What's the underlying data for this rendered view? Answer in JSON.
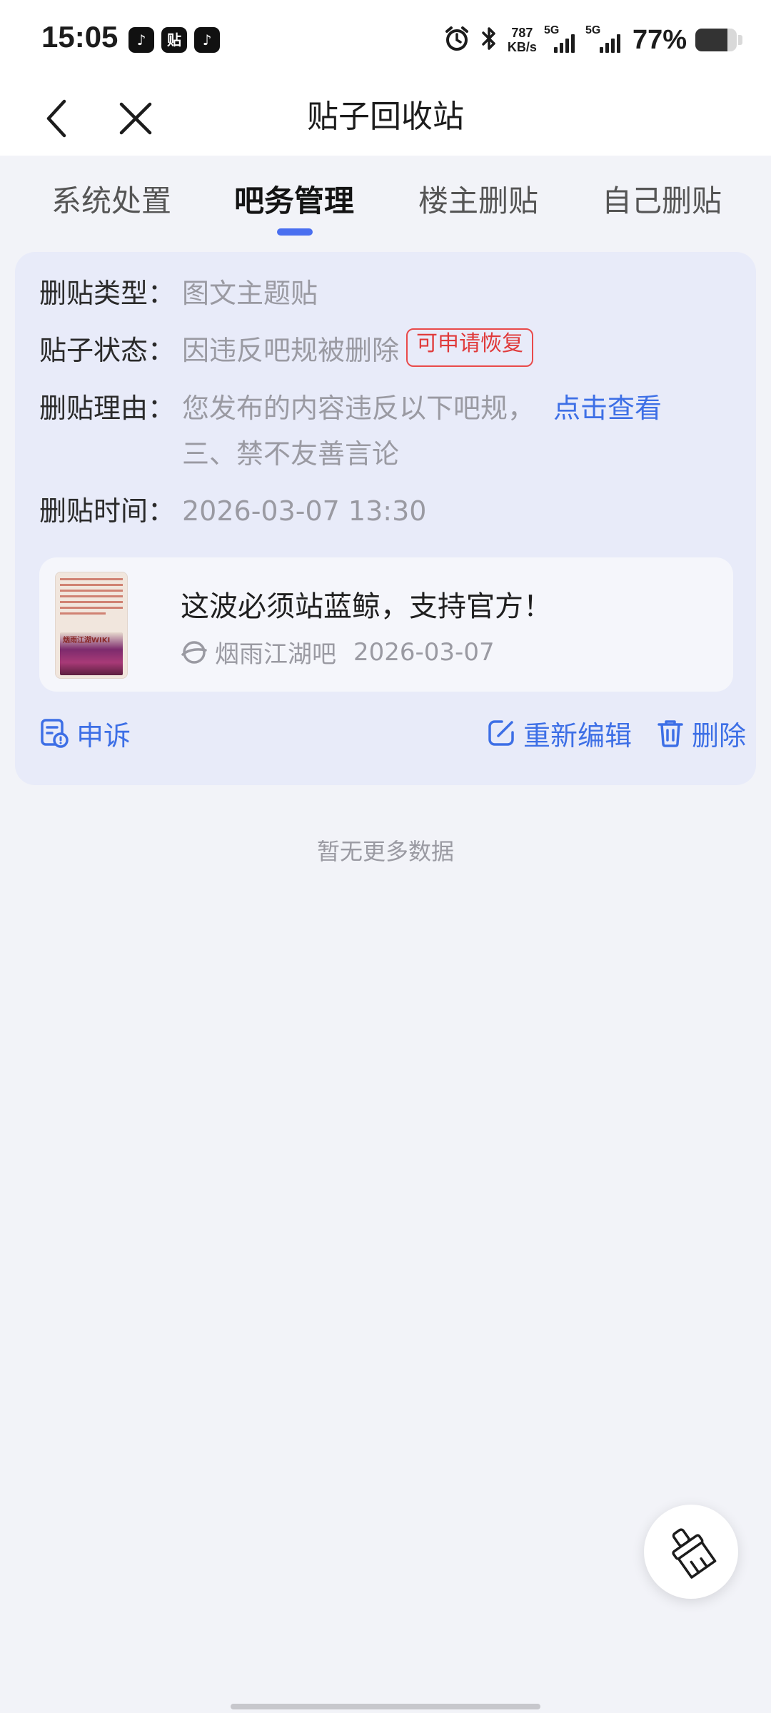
{
  "status_bar": {
    "time": "15:05",
    "app_icons": [
      "tiktok-icon",
      "tieba-icon",
      "tiktok-icon"
    ],
    "tieba_icon_text": "贴",
    "net_speed_value": "787",
    "net_speed_unit": "KB/s",
    "sim1": "5G",
    "sim2": "5G",
    "battery_percent": "77%",
    "battery_level": 0.77
  },
  "nav": {
    "title": "贴子回收站"
  },
  "tabs": [
    {
      "label": "系统处置",
      "active": false
    },
    {
      "label": "吧务管理",
      "active": true
    },
    {
      "label": "楼主删贴",
      "active": false
    },
    {
      "label": "自己删贴",
      "active": false
    }
  ],
  "record": {
    "type_label": "删贴类型：",
    "type_value": "图文主题贴",
    "status_label": "贴子状态：",
    "status_value": "因违反吧规被删除",
    "status_badge": "可申请恢复",
    "reason_label": "删贴理由：",
    "reason_value": "您发布的内容违反以下吧规，",
    "reason_link": "点击查看",
    "reason_detail": "三、禁不友善言论",
    "time_label": "删贴时间：",
    "time_value": "2026-03-07 13:30",
    "post": {
      "title": "这波必须站蓝鲸，支持官方！",
      "forum": "烟雨江湖吧",
      "date": "2026-03-07",
      "thumb_caption": "烟雨江湖WIKI"
    },
    "actions": {
      "appeal": "申诉",
      "reedit": "重新编辑",
      "delete": "删除"
    }
  },
  "footer": {
    "no_more": "暂无更多数据"
  },
  "colors": {
    "accent": "#3d6fe6",
    "badge_red": "#e03a3a",
    "card_bg": "#e8ebf9",
    "page_bg": "#f2f3f8"
  }
}
